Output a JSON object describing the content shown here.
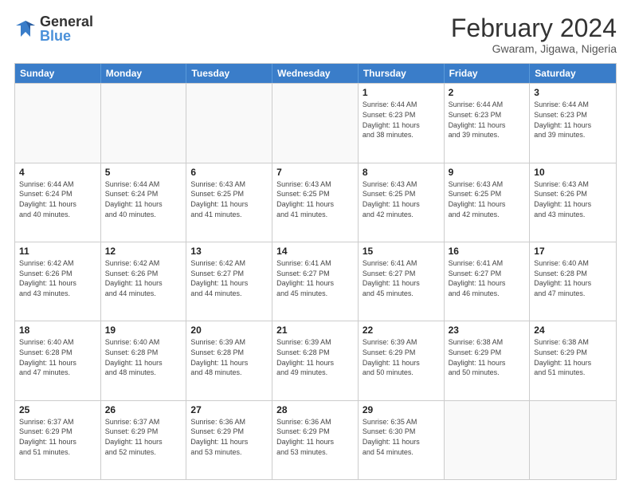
{
  "header": {
    "logo_general": "General",
    "logo_blue": "Blue",
    "month_year": "February 2024",
    "location": "Gwaram, Jigawa, Nigeria"
  },
  "days_of_week": [
    "Sunday",
    "Monday",
    "Tuesday",
    "Wednesday",
    "Thursday",
    "Friday",
    "Saturday"
  ],
  "weeks": [
    [
      {
        "day": "",
        "info": ""
      },
      {
        "day": "",
        "info": ""
      },
      {
        "day": "",
        "info": ""
      },
      {
        "day": "",
        "info": ""
      },
      {
        "day": "1",
        "info": "Sunrise: 6:44 AM\nSunset: 6:23 PM\nDaylight: 11 hours\nand 38 minutes."
      },
      {
        "day": "2",
        "info": "Sunrise: 6:44 AM\nSunset: 6:23 PM\nDaylight: 11 hours\nand 39 minutes."
      },
      {
        "day": "3",
        "info": "Sunrise: 6:44 AM\nSunset: 6:23 PM\nDaylight: 11 hours\nand 39 minutes."
      }
    ],
    [
      {
        "day": "4",
        "info": "Sunrise: 6:44 AM\nSunset: 6:24 PM\nDaylight: 11 hours\nand 40 minutes."
      },
      {
        "day": "5",
        "info": "Sunrise: 6:44 AM\nSunset: 6:24 PM\nDaylight: 11 hours\nand 40 minutes."
      },
      {
        "day": "6",
        "info": "Sunrise: 6:43 AM\nSunset: 6:25 PM\nDaylight: 11 hours\nand 41 minutes."
      },
      {
        "day": "7",
        "info": "Sunrise: 6:43 AM\nSunset: 6:25 PM\nDaylight: 11 hours\nand 41 minutes."
      },
      {
        "day": "8",
        "info": "Sunrise: 6:43 AM\nSunset: 6:25 PM\nDaylight: 11 hours\nand 42 minutes."
      },
      {
        "day": "9",
        "info": "Sunrise: 6:43 AM\nSunset: 6:25 PM\nDaylight: 11 hours\nand 42 minutes."
      },
      {
        "day": "10",
        "info": "Sunrise: 6:43 AM\nSunset: 6:26 PM\nDaylight: 11 hours\nand 43 minutes."
      }
    ],
    [
      {
        "day": "11",
        "info": "Sunrise: 6:42 AM\nSunset: 6:26 PM\nDaylight: 11 hours\nand 43 minutes."
      },
      {
        "day": "12",
        "info": "Sunrise: 6:42 AM\nSunset: 6:26 PM\nDaylight: 11 hours\nand 44 minutes."
      },
      {
        "day": "13",
        "info": "Sunrise: 6:42 AM\nSunset: 6:27 PM\nDaylight: 11 hours\nand 44 minutes."
      },
      {
        "day": "14",
        "info": "Sunrise: 6:41 AM\nSunset: 6:27 PM\nDaylight: 11 hours\nand 45 minutes."
      },
      {
        "day": "15",
        "info": "Sunrise: 6:41 AM\nSunset: 6:27 PM\nDaylight: 11 hours\nand 45 minutes."
      },
      {
        "day": "16",
        "info": "Sunrise: 6:41 AM\nSunset: 6:27 PM\nDaylight: 11 hours\nand 46 minutes."
      },
      {
        "day": "17",
        "info": "Sunrise: 6:40 AM\nSunset: 6:28 PM\nDaylight: 11 hours\nand 47 minutes."
      }
    ],
    [
      {
        "day": "18",
        "info": "Sunrise: 6:40 AM\nSunset: 6:28 PM\nDaylight: 11 hours\nand 47 minutes."
      },
      {
        "day": "19",
        "info": "Sunrise: 6:40 AM\nSunset: 6:28 PM\nDaylight: 11 hours\nand 48 minutes."
      },
      {
        "day": "20",
        "info": "Sunrise: 6:39 AM\nSunset: 6:28 PM\nDaylight: 11 hours\nand 48 minutes."
      },
      {
        "day": "21",
        "info": "Sunrise: 6:39 AM\nSunset: 6:28 PM\nDaylight: 11 hours\nand 49 minutes."
      },
      {
        "day": "22",
        "info": "Sunrise: 6:39 AM\nSunset: 6:29 PM\nDaylight: 11 hours\nand 50 minutes."
      },
      {
        "day": "23",
        "info": "Sunrise: 6:38 AM\nSunset: 6:29 PM\nDaylight: 11 hours\nand 50 minutes."
      },
      {
        "day": "24",
        "info": "Sunrise: 6:38 AM\nSunset: 6:29 PM\nDaylight: 11 hours\nand 51 minutes."
      }
    ],
    [
      {
        "day": "25",
        "info": "Sunrise: 6:37 AM\nSunset: 6:29 PM\nDaylight: 11 hours\nand 51 minutes."
      },
      {
        "day": "26",
        "info": "Sunrise: 6:37 AM\nSunset: 6:29 PM\nDaylight: 11 hours\nand 52 minutes."
      },
      {
        "day": "27",
        "info": "Sunrise: 6:36 AM\nSunset: 6:29 PM\nDaylight: 11 hours\nand 53 minutes."
      },
      {
        "day": "28",
        "info": "Sunrise: 6:36 AM\nSunset: 6:29 PM\nDaylight: 11 hours\nand 53 minutes."
      },
      {
        "day": "29",
        "info": "Sunrise: 6:35 AM\nSunset: 6:30 PM\nDaylight: 11 hours\nand 54 minutes."
      },
      {
        "day": "",
        "info": ""
      },
      {
        "day": "",
        "info": ""
      }
    ]
  ]
}
